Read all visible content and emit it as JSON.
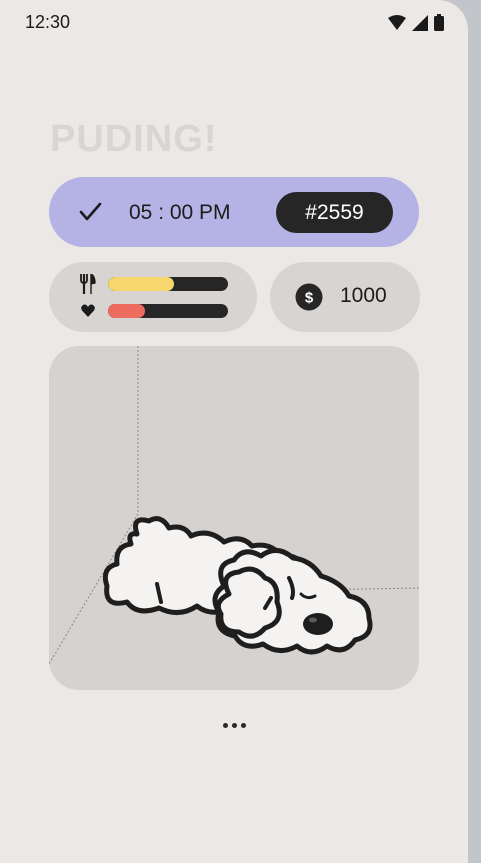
{
  "status_bar": {
    "time": "12:30",
    "icons": [
      "wifi-icon",
      "signal-icon",
      "battery-icon"
    ]
  },
  "app": {
    "title": "PUDING!"
  },
  "alarm": {
    "time": "05 : 00 PM",
    "id": "#2559",
    "icon": "check-icon",
    "accent": "#b5b2e5"
  },
  "stats": {
    "hunger": {
      "icon": "fork-knife-icon",
      "level": 0.55,
      "color": "#f5d76e"
    },
    "health": {
      "icon": "heart-icon",
      "level": 0.31,
      "color": "#ee6b60"
    }
  },
  "coins": {
    "icon": "dollar-coin-icon",
    "amount": "1000"
  },
  "pet": {
    "name": "sleeping-puppy"
  },
  "menu": {
    "icon": "more-dots-icon"
  }
}
